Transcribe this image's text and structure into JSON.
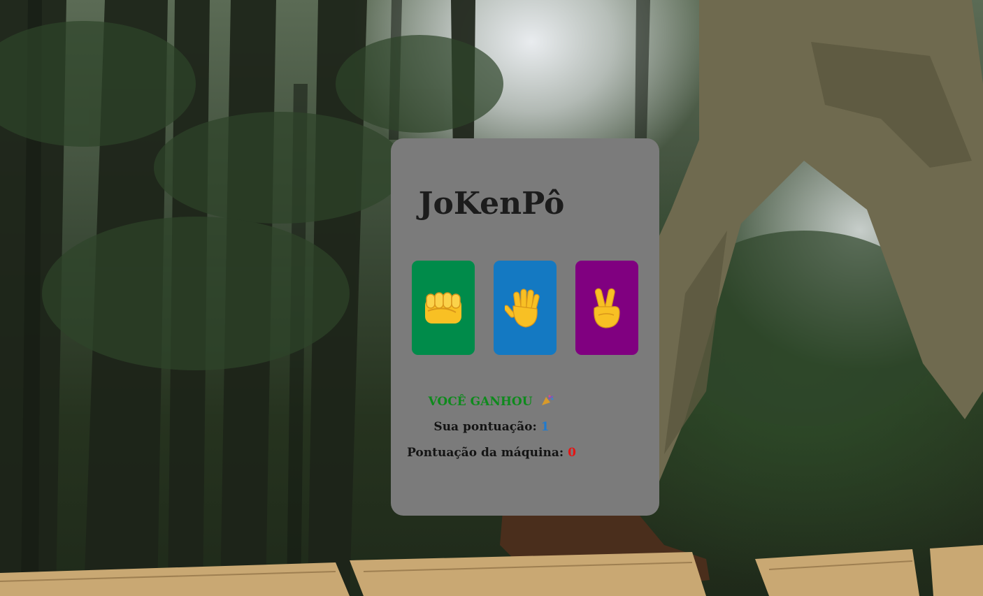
{
  "game": {
    "title": "JoKenPô",
    "choices": [
      {
        "name": "rock",
        "color": "#008b4a",
        "icon": "fist-icon"
      },
      {
        "name": "paper",
        "color": "#1479c2",
        "icon": "raised-hand-icon"
      },
      {
        "name": "scissors",
        "color": "#800080",
        "icon": "victory-hand-icon"
      }
    ]
  },
  "result": {
    "message": "VOCÊ GANHOU",
    "icon": "party-popper-icon",
    "user_label": "Sua pontuação:",
    "user_score": "1",
    "machine_label": "Pontuação da máquina:",
    "machine_score": "0"
  },
  "colors": {
    "card": "#7b7b7b",
    "win": "#0e8a1c",
    "user_score": "#1e7bd0",
    "machine_score": "#e41414"
  }
}
